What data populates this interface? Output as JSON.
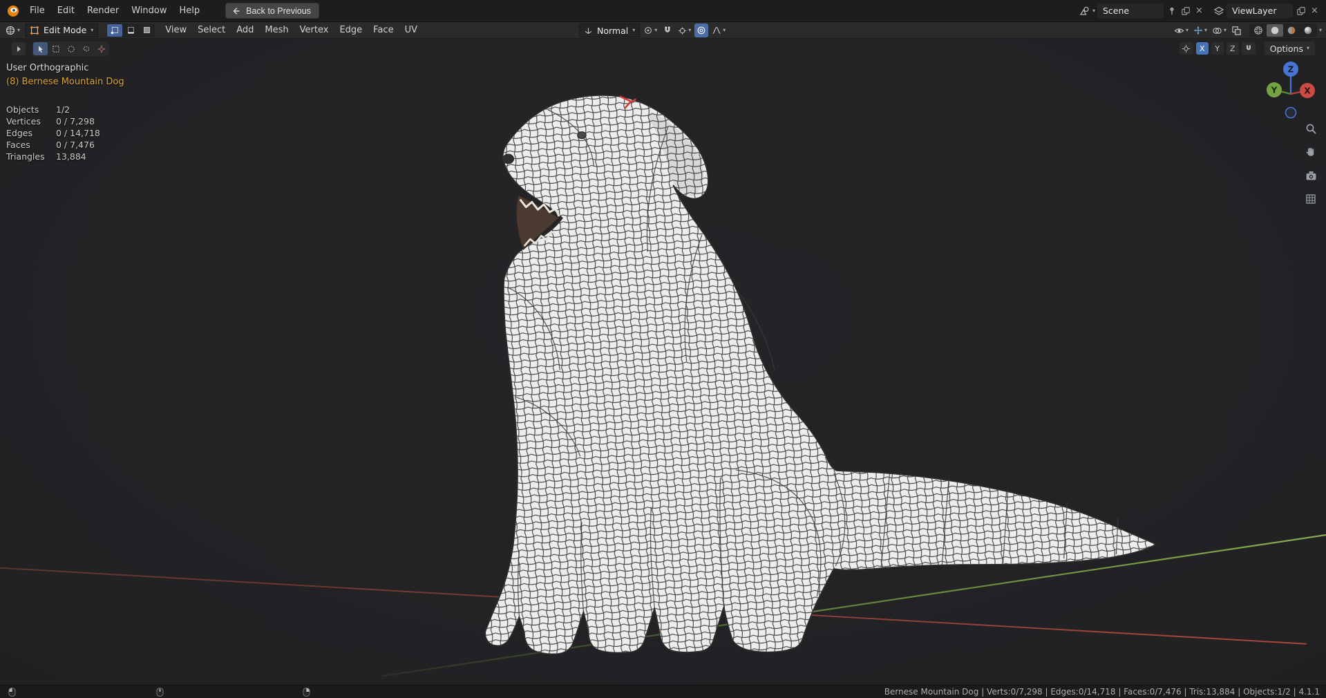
{
  "topbar": {
    "menus": [
      "File",
      "Edit",
      "Render",
      "Window",
      "Help"
    ],
    "back_button_label": "Back to Previous",
    "scene_field": "Scene",
    "viewlayer_field": "ViewLayer"
  },
  "header": {
    "mode_select": "Edit Mode",
    "menus": [
      "View",
      "Select",
      "Add",
      "Mesh",
      "Vertex",
      "Edge",
      "Face",
      "UV"
    ],
    "orientation": "Normal",
    "row2": {
      "axis": [
        "X",
        "Y",
        "Z"
      ],
      "options_label": "Options"
    }
  },
  "overlay": {
    "view_label": "User Orthographic",
    "active_object": "(8) Bernese Mountain Dog",
    "stats": [
      {
        "label": "Objects",
        "value": "1/2"
      },
      {
        "label": "Vertices",
        "value": "0 / 7,298"
      },
      {
        "label": "Edges",
        "value": "0 / 14,718"
      },
      {
        "label": "Faces",
        "value": "0 / 7,476"
      },
      {
        "label": "Triangles",
        "value": "13,884"
      }
    ]
  },
  "gizmo": {
    "x": "X",
    "y": "Y",
    "z": "Z"
  },
  "statusbar": {
    "info": "Bernese Mountain Dog | Verts:0/7,298 | Edges:0/14,718 | Faces:0/7,476 | Tris:13,884 | Objects:1/2 | 4.1.1"
  },
  "colors": {
    "accent": "#4772b3",
    "axis_x": "#cc4b44",
    "axis_y": "#76a343",
    "axis_z": "#4a74d4",
    "active_object_text": "#d9a62e"
  }
}
